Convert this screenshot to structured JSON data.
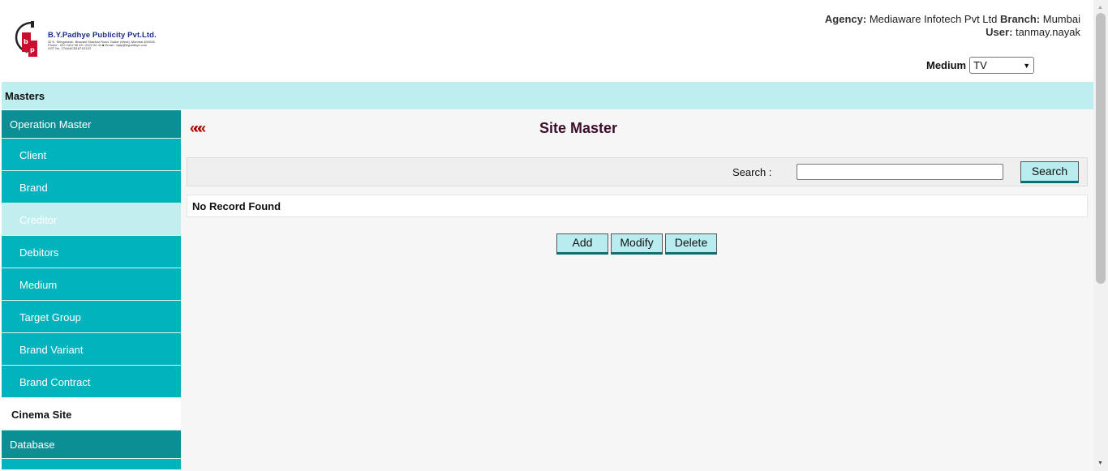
{
  "header": {
    "logo": {
      "company": "B.Y.Padhye Publicity Pvt.Ltd.",
      "address_lines": [
        "32 E, Shivganesh, Bhavani Shankar Road, Dadar (West), Mumbai 400028.",
        "Phone : 022 2422 06 45 / 2422 02 41  ■  Email : vijay@bypadhye.com",
        "GST No. 27AAACB1871D1Z2"
      ]
    },
    "agency_label": "Agency:",
    "agency_value": "Mediaware Infotech Pvt Ltd",
    "branch_label": "Branch:",
    "branch_value": "Mumbai",
    "user_label": "User:",
    "user_value": "tanmay.nayak",
    "medium_label": "Medium",
    "medium_value": "TV"
  },
  "masters_bar": {
    "label": "Masters"
  },
  "sidebar": {
    "group_operation": "Operation Master",
    "items": [
      {
        "label": "Client"
      },
      {
        "label": "Brand"
      },
      {
        "label": "Creditor"
      },
      {
        "label": "Debitors"
      },
      {
        "label": "Medium"
      },
      {
        "label": "Target Group"
      },
      {
        "label": "Brand Variant"
      },
      {
        "label": "Brand Contract"
      },
      {
        "label": "Cinema Site"
      }
    ],
    "group_database": "Database"
  },
  "main": {
    "title": "Site Master",
    "back_icon": "«««",
    "search_label": "Search :",
    "search_value": "",
    "search_button": "Search",
    "result_text": "No Record Found",
    "buttons": {
      "add": "Add",
      "modify": "Modify",
      "delete": "Delete"
    }
  },
  "colors": {
    "masters_bar": "#bfeef0",
    "sidebar_group": "#0c8e95",
    "sidebar_item": "#00b3bd",
    "title": "#3d0c2a",
    "back_arrows": "#b30000",
    "button_bg": "#b9ecef"
  }
}
